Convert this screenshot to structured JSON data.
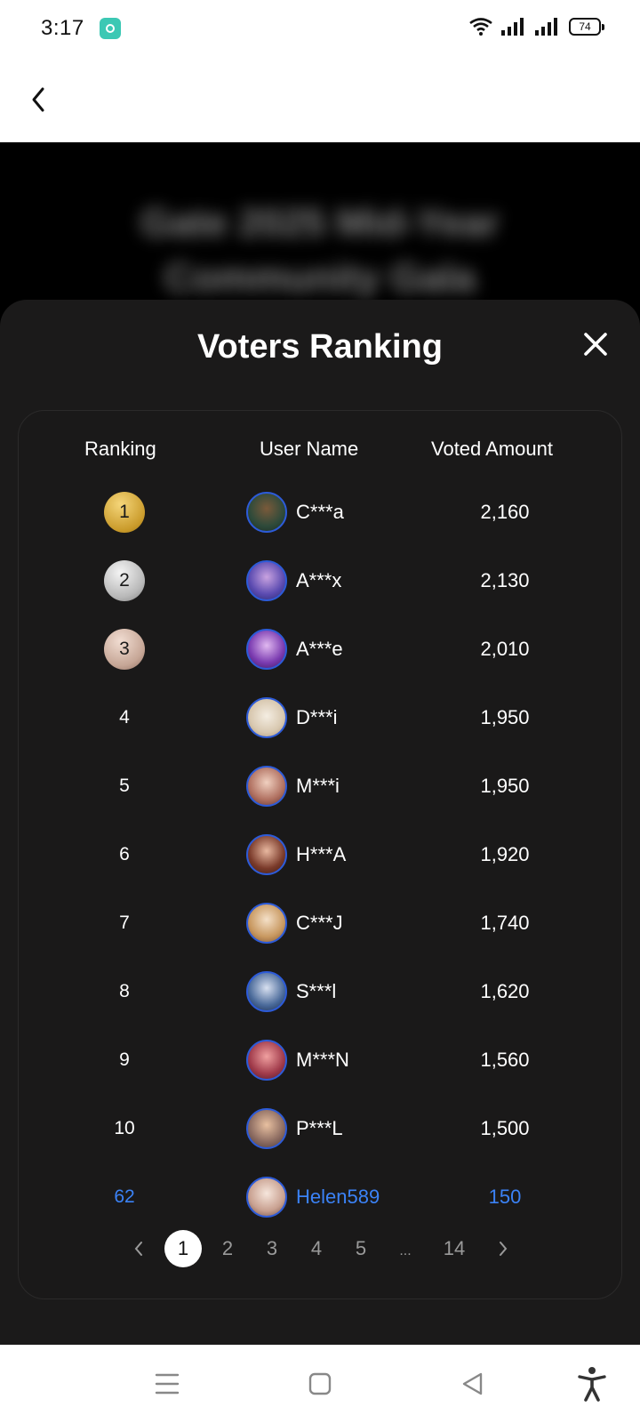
{
  "status_bar": {
    "time": "3:17",
    "battery": "74"
  },
  "backdrop": {
    "title": "Gate 2025 Mid-Year Community Gala"
  },
  "modal": {
    "title": "Voters Ranking",
    "columns": {
      "ranking": "Ranking",
      "user_name": "User Name",
      "voted_amount": "Voted Amount"
    },
    "rows": [
      {
        "rank": "1",
        "user": "C***a",
        "amount": "2,160",
        "medal": "gold"
      },
      {
        "rank": "2",
        "user": "A***x",
        "amount": "2,130",
        "medal": "silver"
      },
      {
        "rank": "3",
        "user": "A***e",
        "amount": "2,010",
        "medal": "bronze"
      },
      {
        "rank": "4",
        "user": "D***i",
        "amount": "1,950"
      },
      {
        "rank": "5",
        "user": "M***i",
        "amount": "1,950"
      },
      {
        "rank": "6",
        "user": "H***A",
        "amount": "1,920"
      },
      {
        "rank": "7",
        "user": "C***J",
        "amount": "1,740"
      },
      {
        "rank": "8",
        "user": "S***l",
        "amount": "1,620"
      },
      {
        "rank": "9",
        "user": "M***N",
        "amount": "1,560"
      },
      {
        "rank": "10",
        "user": "P***L",
        "amount": "1,500"
      }
    ],
    "current_user": {
      "rank": "62",
      "user": "Helen589",
      "amount": "150"
    },
    "pagination": {
      "pages": [
        "1",
        "2",
        "3",
        "4",
        "5"
      ],
      "ellipsis": "...",
      "last": "14",
      "current": "1"
    }
  },
  "colors": {
    "highlight": "#3b82f6",
    "sheet_bg": "#1b1a1a",
    "avatar_ring": "#2d5bd8"
  }
}
